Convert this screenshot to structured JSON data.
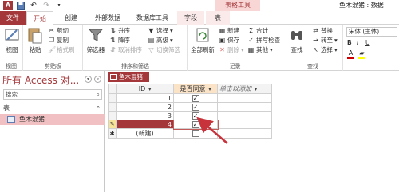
{
  "window": {
    "context_tab_title": "表格工具",
    "app_title": "鱼木混猪 : 数据"
  },
  "tabs": [
    {
      "label": "文件"
    },
    {
      "label": "开始"
    },
    {
      "label": "创建"
    },
    {
      "label": "外部数据"
    },
    {
      "label": "数据库工具"
    },
    {
      "label": "字段"
    },
    {
      "label": "表"
    }
  ],
  "ribbon": {
    "view": {
      "label": "视图",
      "group": "视图"
    },
    "clipboard": {
      "paste": "粘贴",
      "cut": "剪切",
      "copy": "复制",
      "format_painter": "格式刷",
      "group": "剪贴板"
    },
    "sort_filter": {
      "filter": "筛选器",
      "asc": "升序",
      "desc": "降序",
      "clear_sort": "取消排序",
      "selection": "选择",
      "advanced": "高级",
      "toggle_filter": "切换筛选",
      "group": "排序和筛选"
    },
    "records": {
      "refresh_all": "全部刷新",
      "new": "新建",
      "save": "保存",
      "delete": "删除",
      "totals": "合计",
      "spelling": "拼写检查",
      "more": "其他",
      "group": "记录"
    },
    "find": {
      "find": "查找",
      "replace": "替换",
      "goto": "转至",
      "select": "选择",
      "group": "查找"
    },
    "text": {
      "font": "宋体 (主体)"
    }
  },
  "nav": {
    "title": "所有 Access 对...",
    "search_placeholder": "搜索...",
    "category": "表",
    "items": [
      {
        "label": "鱼木混猪"
      }
    ]
  },
  "document": {
    "tab_label": "鱼木混猪",
    "columns": {
      "id": "ID",
      "bool": "是否同意",
      "add": "单击以添加"
    },
    "rows": [
      {
        "id": "1",
        "checked": true
      },
      {
        "id": "2",
        "checked": true
      },
      {
        "id": "3",
        "checked": true
      },
      {
        "id": "4",
        "checked": true
      }
    ],
    "new_row_label": "(新建)"
  },
  "colors": {
    "accent": "#a4373a",
    "arrow": "#c8323a"
  }
}
